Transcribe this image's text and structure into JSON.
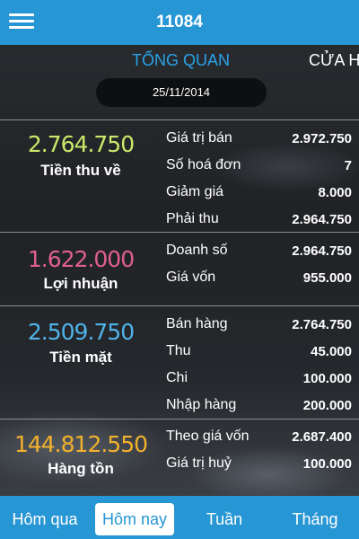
{
  "header": {
    "title": "11084",
    "menu_icon": "hamburger-menu-icon"
  },
  "tabs": [
    {
      "label": "TỔNG QUAN",
      "active": true
    },
    {
      "label": "CỬA H",
      "active": false
    }
  ],
  "date": "25/11/2014",
  "sections": [
    {
      "amount": "2.764.750",
      "amount_color": "#c9e96a",
      "label": "Tiền thu về",
      "rows": [
        {
          "label": "Giá trị bán",
          "value": "2.972.750"
        },
        {
          "label": "Số hoá đơn",
          "value": "7"
        },
        {
          "label": "Giảm giá",
          "value": "8.000"
        },
        {
          "label": "Phải thu",
          "value": "2.964.750"
        }
      ]
    },
    {
      "amount": "1.622.000",
      "amount_color": "#e0608c",
      "label": "Lợi nhuận",
      "rows": [
        {
          "label": "Doanh số",
          "value": "2.964.750"
        },
        {
          "label": "Giá vốn",
          "value": "955.000"
        }
      ]
    },
    {
      "amount": "2.509.750",
      "amount_color": "#4fb3e8",
      "label": "Tiền mặt",
      "rows": [
        {
          "label": "Bán hàng",
          "value": "2.764.750"
        },
        {
          "label": "Thu",
          "value": "45.000"
        },
        {
          "label": "Chi",
          "value": "100.000"
        },
        {
          "label": "Nhập hàng",
          "value": "200.000"
        }
      ]
    },
    {
      "amount": "144.812.550",
      "amount_color": "#f2b12c",
      "label": "Hàng tồn",
      "rows": [
        {
          "label": "Theo giá vốn",
          "value": "2.687.400"
        },
        {
          "label": "Giá trị huỷ",
          "value": "100.000"
        }
      ]
    }
  ],
  "bottom_nav": [
    {
      "label": "Hôm qua",
      "active": false
    },
    {
      "label": "Hôm nay",
      "active": true
    },
    {
      "label": "Tuần",
      "active": false
    },
    {
      "label": "Tháng",
      "active": false
    }
  ],
  "colors": {
    "brand_blue": "#2796d4",
    "active_tab_text": "#2aa3e8",
    "date_pill_bg": "#0e0f11"
  }
}
